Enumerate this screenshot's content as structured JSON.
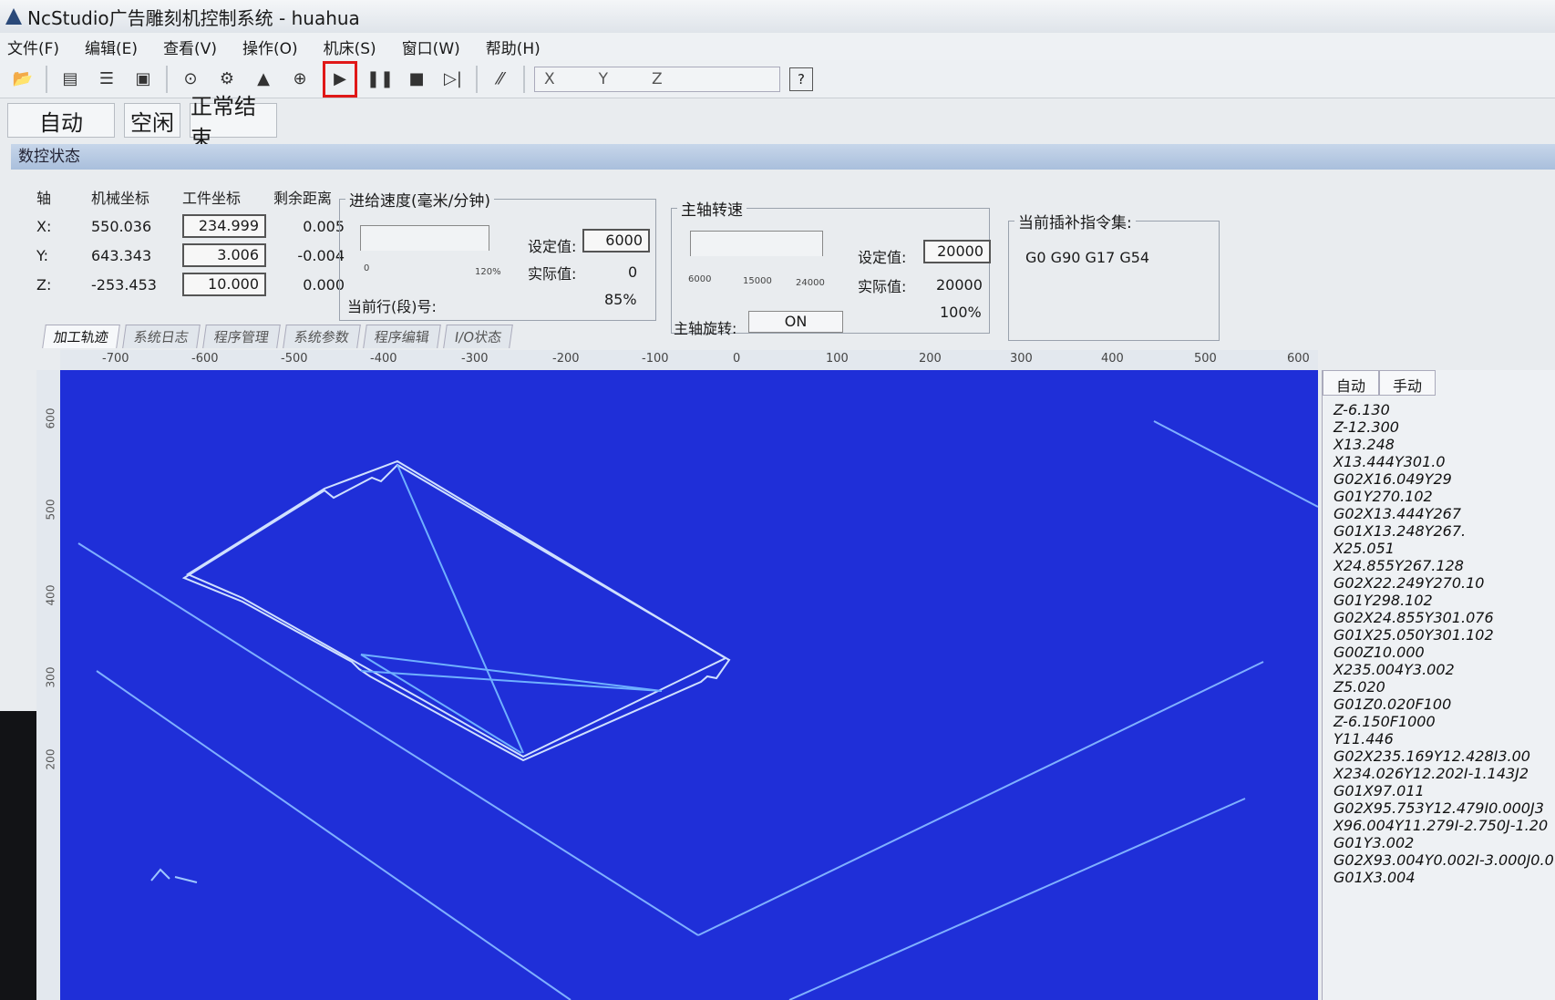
{
  "window": {
    "title": "NcStudio广告雕刻机控制系统 - huahua"
  },
  "menu": [
    "文件(F)",
    "编辑(E)",
    "查看(V)",
    "操作(O)",
    "机床(S)",
    "窗口(W)",
    "帮助(H)"
  ],
  "toolbar": {
    "coord_labels": [
      "X",
      "Y",
      "Z"
    ],
    "help": "?"
  },
  "status": {
    "mode": "自动",
    "state": "空闲",
    "result": "正常结束"
  },
  "section_title": "数控状态",
  "axes": {
    "headers": [
      "轴",
      "机械坐标",
      "工件坐标",
      "剩余距离"
    ],
    "rows": [
      {
        "axis": "X:",
        "machine": "550.036",
        "work": "234.999",
        "remain": "0.005"
      },
      {
        "axis": "Y:",
        "machine": "643.343",
        "work": "3.006",
        "remain": "-0.004"
      },
      {
        "axis": "Z:",
        "machine": "-253.453",
        "work": "10.000",
        "remain": "0.000"
      }
    ]
  },
  "feed": {
    "legend": "进给速度(毫米/分钟)",
    "set_label": "设定值:",
    "set_value": "6000",
    "actual_label": "实际值:",
    "actual_value": "0",
    "percent": "85%",
    "tick_min": "0",
    "tick_max": "120%",
    "line_label": "当前行(段)号:"
  },
  "spindle": {
    "legend": "主轴转速",
    "set_label": "设定值:",
    "set_value": "20000",
    "actual_label": "实际值:",
    "actual_value": "20000",
    "percent": "100%",
    "ticks": [
      "6000",
      "15000",
      "24000"
    ],
    "rotate_label": "主轴旋转:",
    "rotate_value": "ON"
  },
  "interp": {
    "legend": "当前插补指令集:",
    "value": "G0 G90 G17 G54"
  },
  "tabs": [
    "加工轨迹",
    "系统日志",
    "程序管理",
    "系统参数",
    "程序编辑",
    "I/O状态"
  ],
  "ruler_x": [
    "-700",
    "-600",
    "-500",
    "-400",
    "-300",
    "-200",
    "-100",
    "0",
    "100",
    "200",
    "300",
    "400",
    "500",
    "600"
  ],
  "ruler_y": [
    "600",
    "500",
    "400",
    "300",
    "200"
  ],
  "right_tabs": [
    "自动",
    "手动"
  ],
  "gcode": [
    "Z-6.130",
    "Z-12.300",
    "X13.248",
    "X13.444Y301.0",
    "G02X16.049Y29",
    "G01Y270.102",
    "G02X13.444Y267",
    "G01X13.248Y267.",
    "X25.051",
    "X24.855Y267.128",
    "G02X22.249Y270.10",
    "G01Y298.102",
    "G02X24.855Y301.076",
    "G01X25.050Y301.102",
    "G00Z10.000",
    "X235.004Y3.002",
    "Z5.020",
    "G01Z0.020F100",
    "Z-6.150F1000",
    "Y11.446",
    "G02X235.169Y12.428I3.00",
    "X234.026Y12.202I-1.143J2",
    "G01X97.011",
    "G02X95.753Y12.479I0.000J3",
    "X96.004Y11.279I-2.750J-1.20",
    "G01Y3.002",
    "G02X93.004Y0.002I-3.000J0.0",
    "G01X3.004"
  ],
  "colors": {
    "viewport": "#1f2fd8",
    "toolpath": "#9fc8ff",
    "highlight": "#e01818"
  },
  "icons": [
    "open-file-icon",
    "print-preview-icon",
    "list-icon",
    "window-icon",
    "probe-icon",
    "spindle-icon",
    "tool-height-icon",
    "set-origin-icon",
    "start-icon",
    "pause-icon",
    "stop-icon",
    "step-icon",
    "breakpoint-icon",
    "help-icon"
  ]
}
